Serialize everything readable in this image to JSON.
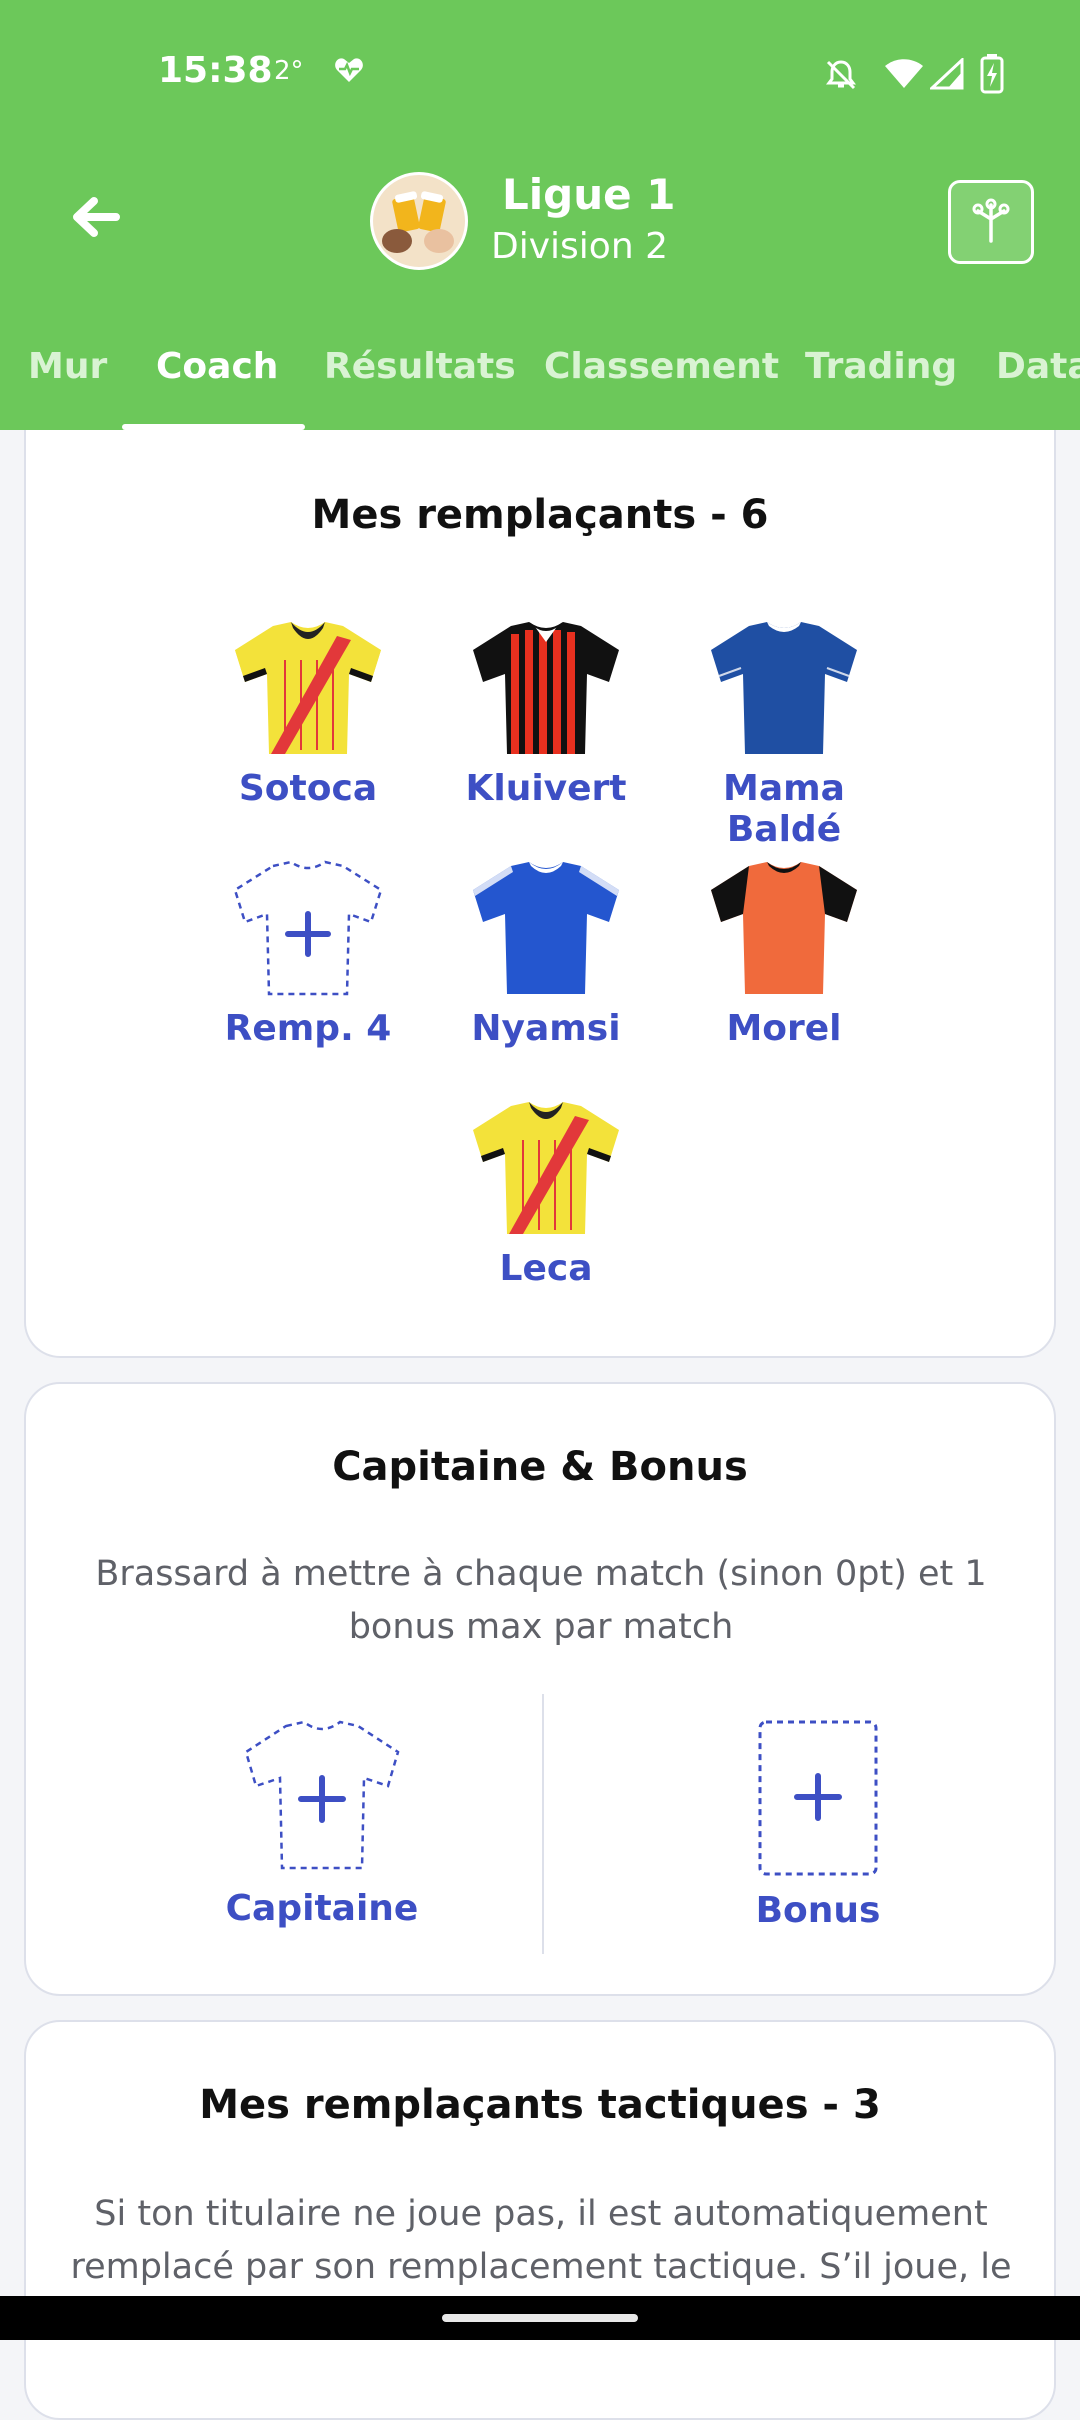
{
  "status_bar": {
    "time": "15:38",
    "temperature": "2°",
    "icons": [
      "health-icon",
      "mute-icon",
      "wifi-icon",
      "signal-icon",
      "battery-charging-icon"
    ]
  },
  "header": {
    "title": "Ligue 1",
    "subtitle": "Division 2",
    "back_icon": "arrow-left-icon",
    "avatar": "beer-toast-avatar",
    "action_icon": "tree-icon",
    "color": "#6cc85a"
  },
  "tabs": [
    {
      "label": "Mur"
    },
    {
      "label": "Coach",
      "active": true
    },
    {
      "label": "Résultats"
    },
    {
      "label": "Classement"
    },
    {
      "label": "Trading"
    },
    {
      "label": "Data"
    }
  ],
  "substitutes": {
    "title": "Mes remplaçants - 6",
    "players": [
      {
        "name": "Sotoca",
        "jersey": "lens"
      },
      {
        "name": "Kluivert",
        "jersey": "nice"
      },
      {
        "name": "Mama Baldé",
        "jersey": "navy"
      },
      {
        "name": "Remp. 4",
        "jersey": "empty"
      },
      {
        "name": "Nyamsi",
        "jersey": "blue"
      },
      {
        "name": "Morel",
        "jersey": "orange"
      },
      {
        "name": "Leca",
        "jersey": "lens"
      }
    ]
  },
  "captain_bonus": {
    "title": "Capitaine & Bonus",
    "description": "Brassard à mettre à chaque match (sinon 0pt) et 1 bonus max par match",
    "captain_label": "Capitaine",
    "bonus_label": "Bonus"
  },
  "tactical": {
    "title": "Mes remplaçants tactiques - 3",
    "description": "Si ton titulaire ne joue pas, il est automatiquement remplacé par son remplacement tactique. S’il joue, le"
  },
  "colors": {
    "accent_green": "#6cc85a",
    "link_blue": "#3d4fc4",
    "lens_yellow": "#f3e23a",
    "lens_red": "#e2383a",
    "nice_red": "#e8301f",
    "navy": "#1f4fa3",
    "blue": "#2456cf",
    "orange": "#f06a3c"
  }
}
